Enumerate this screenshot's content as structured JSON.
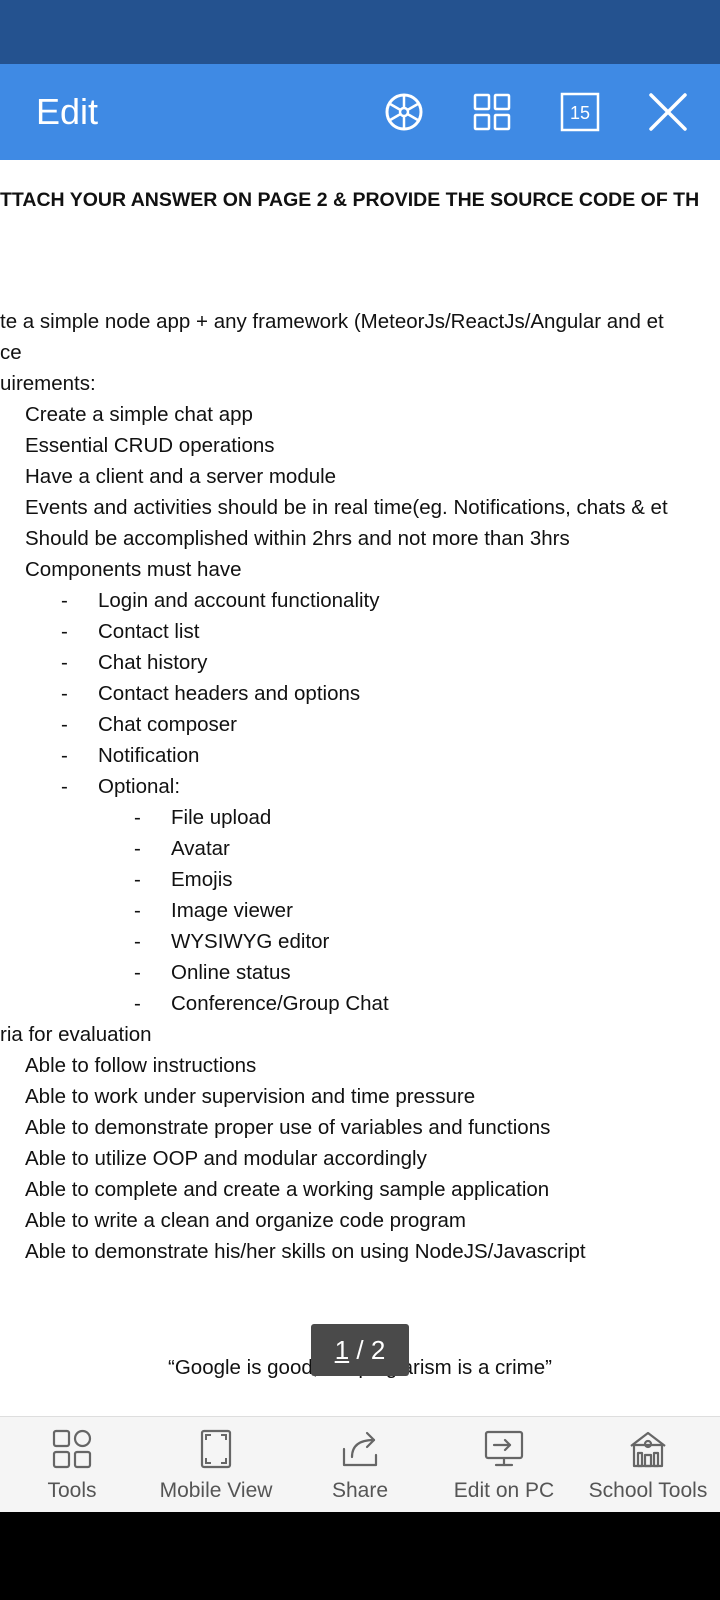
{
  "header": {
    "title": "Edit",
    "page_count_badge": "15",
    "icons": [
      "wheel-icon",
      "grid-icon",
      "page-count-icon",
      "close-icon"
    ]
  },
  "document": {
    "lines": [
      "TTACH YOUR ANSWER ON PAGE 2 & PROVIDE THE SOURCE CODE OF TH",
      "te a simple node app + any framework (MeteorJs/ReactJs/Angular and et",
      "ce",
      "uirements:",
      "Create a simple chat app",
      "Essential CRUD operations",
      "Have a client and a server module",
      "Events and activities should be in real time(eg. Notifications, chats & et",
      "Should be accomplished within 2hrs and not more than 3hrs",
      "Components must have",
      "Login and account functionality",
      "Contact list",
      "Chat history",
      "Contact headers and options",
      "Chat composer",
      "Notification",
      "Optional:",
      "File upload",
      "Avatar",
      "Emojis",
      "Image viewer",
      "WYSIWYG editor",
      "Online status",
      "Conference/Group Chat",
      "ria for evaluation",
      "Able to follow instructions",
      "Able to work under supervision and time pressure",
      "Able to demonstrate proper use of variables and functions",
      "Able to utilize OOP and modular accordingly",
      "Able to complete and create a working sample application",
      "Able to write a clean and organize code program",
      "Able to demonstrate his/her skills on using NodeJS/Javascript",
      "“Google is good, but plagiarism is a crime”"
    ],
    "dash": "-"
  },
  "pagination": {
    "current": "1",
    "separator": " / ",
    "total": "2"
  },
  "toolbar": {
    "items": [
      {
        "label": "Tools",
        "icon": "tools-icon"
      },
      {
        "label": "Mobile View",
        "icon": "mobile-view-icon"
      },
      {
        "label": "Share",
        "icon": "share-icon"
      },
      {
        "label": "Edit on PC",
        "icon": "edit-on-pc-icon"
      },
      {
        "label": "School Tools",
        "icon": "school-tools-icon"
      }
    ]
  },
  "colors": {
    "status_bar": "#24528f",
    "app_bar": "#3f8ae4",
    "toolbar_bg": "#f5f5f5",
    "page_indicator": "#4a4a4a"
  }
}
